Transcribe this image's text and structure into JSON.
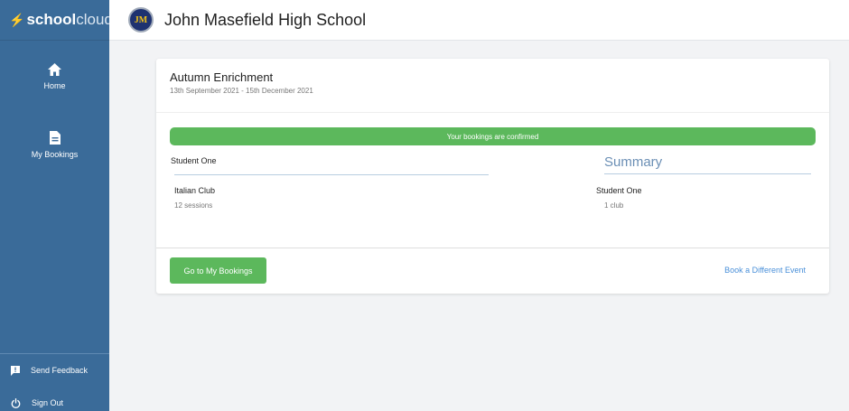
{
  "sidebar": {
    "brand_bold": "school",
    "brand_light": "cloud",
    "nav": [
      {
        "label": "Home",
        "icon": "home-icon"
      },
      {
        "label": "My Bookings",
        "icon": "document-icon"
      }
    ],
    "footer": [
      {
        "label": "Send Feedback",
        "icon": "feedback-icon"
      },
      {
        "label": "Sign Out",
        "icon": "power-icon"
      }
    ]
  },
  "header": {
    "logo_text": "JM",
    "school_name": "John Masefield High School"
  },
  "event": {
    "title": "Autumn Enrichment",
    "dates": "13th September 2021 - 15th December 2021"
  },
  "confirmation": "Your bookings are confirmed",
  "student": {
    "name": "Student One",
    "club": "Italian Club",
    "sessions": "12 sessions"
  },
  "summary": {
    "title": "Summary",
    "student": "Student One",
    "count": "1 club"
  },
  "actions": {
    "go_label": "Go to My Bookings",
    "other_label": "Book a Different Event"
  },
  "colors": {
    "sidebar": "#3a6b99",
    "success": "#5cb85c",
    "link": "#4a90d9",
    "summary_heading": "#6b8fb5"
  }
}
